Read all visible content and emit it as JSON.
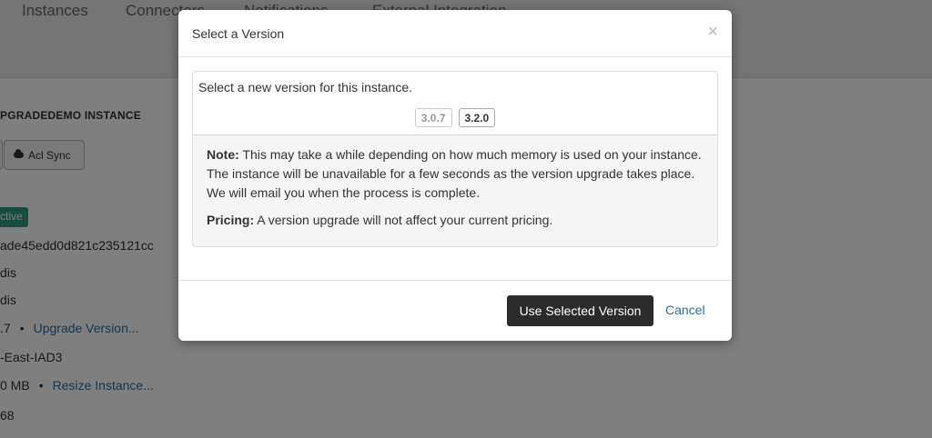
{
  "background": {
    "tabs": [
      "Instances",
      "Connectors",
      "Notifications",
      "External Integration"
    ],
    "instance_title": "PGRADEDEMO INSTANCE",
    "acl_sync_label": "Acl Sync",
    "status_badge": "ctive",
    "instance_id": "ade45edd0d821c235121cc",
    "engine_type": "dis",
    "engine_name": "dis",
    "version_value": ".7",
    "upgrade_link": "Upgrade Version...",
    "region": "-East-IAD3",
    "memory_value": "0 MB",
    "resize_link": "Resize Instance...",
    "port": "68"
  },
  "modal": {
    "title": "Select a Version",
    "close_glyph": "×",
    "intro": "Select a new version for this instance.",
    "versions": [
      {
        "label": "3.0.7",
        "selected": false
      },
      {
        "label": "3.2.0",
        "selected": true
      }
    ],
    "note_label": "Note:",
    "note_text": " This may take a while depending on how much memory is used on your instance. The instance will be unavailable for a few seconds as the version upgrade takes place. We will email you when the process is complete.",
    "pricing_label": "Pricing:",
    "pricing_text": " A version upgrade will not affect your current pricing.",
    "use_selected_label": "Use Selected Version",
    "cancel_label": "Cancel"
  },
  "colors": {
    "primary_button": "#2b2b2b",
    "link": "#2a6fa8",
    "active_badge": "#2c9a7e"
  }
}
